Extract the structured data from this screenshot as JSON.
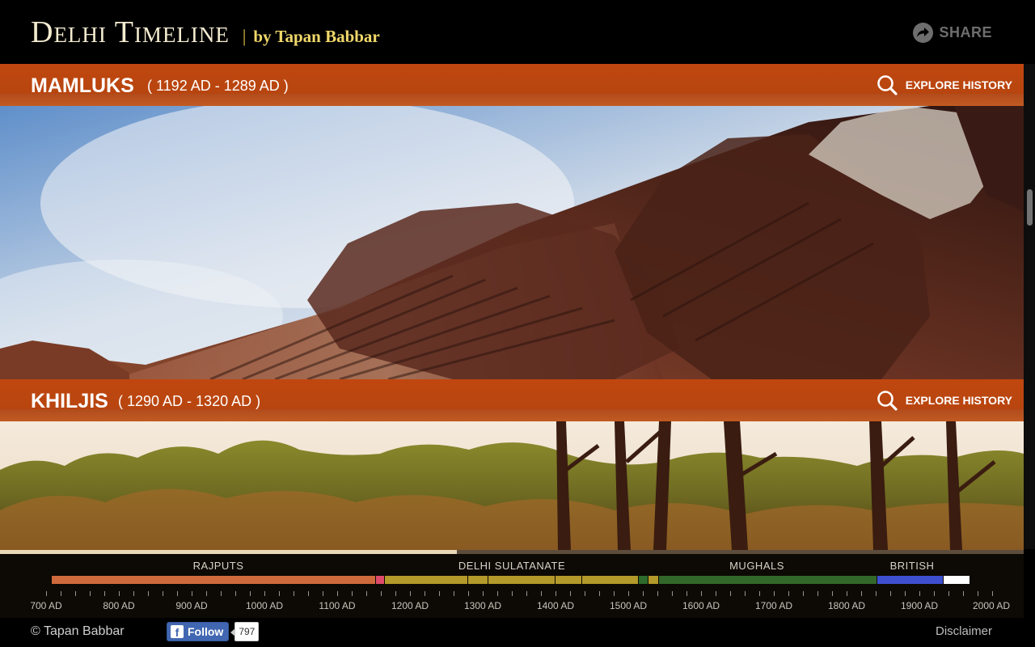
{
  "header": {
    "title": "Delhi Timeline",
    "separator": "|",
    "byline": "by Tapan Babbar",
    "share_label": "SHARE"
  },
  "eras": [
    {
      "name": "MAMLUKS",
      "range": "( 1192 AD - 1289 AD )",
      "explore_label": "EXPLORE HISTORY"
    },
    {
      "name": "KHILJIS",
      "range": "( 1290 AD - 1320 AD )",
      "explore_label": "EXPLORE HISTORY"
    }
  ],
  "timeline": {
    "start_year": 700,
    "end_year": 2000,
    "progress_fraction": 0.446,
    "periods": [
      {
        "label": "RAJPUTS"
      },
      {
        "label": "DELHI SULATANATE"
      },
      {
        "label": "MUGHALS"
      },
      {
        "label": "BRITISH"
      }
    ],
    "segments": [
      {
        "from": 700,
        "to": 1153,
        "color": "#cf6a3c"
      },
      {
        "from": 1153,
        "to": 1166,
        "color": "#e04a6a"
      },
      {
        "from": 1166,
        "to": 1280,
        "color": "#b49a2a"
      },
      {
        "from": 1280,
        "to": 1308,
        "color": "#b49a2a"
      },
      {
        "from": 1308,
        "to": 1400,
        "color": "#b49a2a"
      },
      {
        "from": 1400,
        "to": 1437,
        "color": "#b49a2a"
      },
      {
        "from": 1437,
        "to": 1514,
        "color": "#b49a2a"
      },
      {
        "from": 1514,
        "to": 1528,
        "color": "#2e6b2c"
      },
      {
        "from": 1528,
        "to": 1542,
        "color": "#b49a2a"
      },
      {
        "from": 1542,
        "to": 1842,
        "color": "#33682b"
      },
      {
        "from": 1842,
        "to": 1933,
        "color": "#3e4fd0"
      },
      {
        "from": 1933,
        "to": 1970,
        "color": "#ffffff"
      }
    ],
    "year_labels": [
      "700 AD",
      "800 AD",
      "900 AD",
      "1000 AD",
      "1100 AD",
      "1200 AD",
      "1300 AD",
      "1400 AD",
      "1500 AD",
      "1600 AD",
      "1700 AD",
      "1800 AD",
      "1900 AD",
      "2000 AD"
    ]
  },
  "footer": {
    "copyright": "© Tapan Babbar",
    "fb_label": "Follow",
    "fb_count": "797",
    "disclaimer": "Disclaimer"
  },
  "icons": {
    "share": "share-icon",
    "explore": "search-icon",
    "facebook": "facebook-icon"
  },
  "colors": {
    "era_bar": "#c0470f",
    "brand_title": "#f4ecd0",
    "brand_byline": "#f0d76a"
  }
}
